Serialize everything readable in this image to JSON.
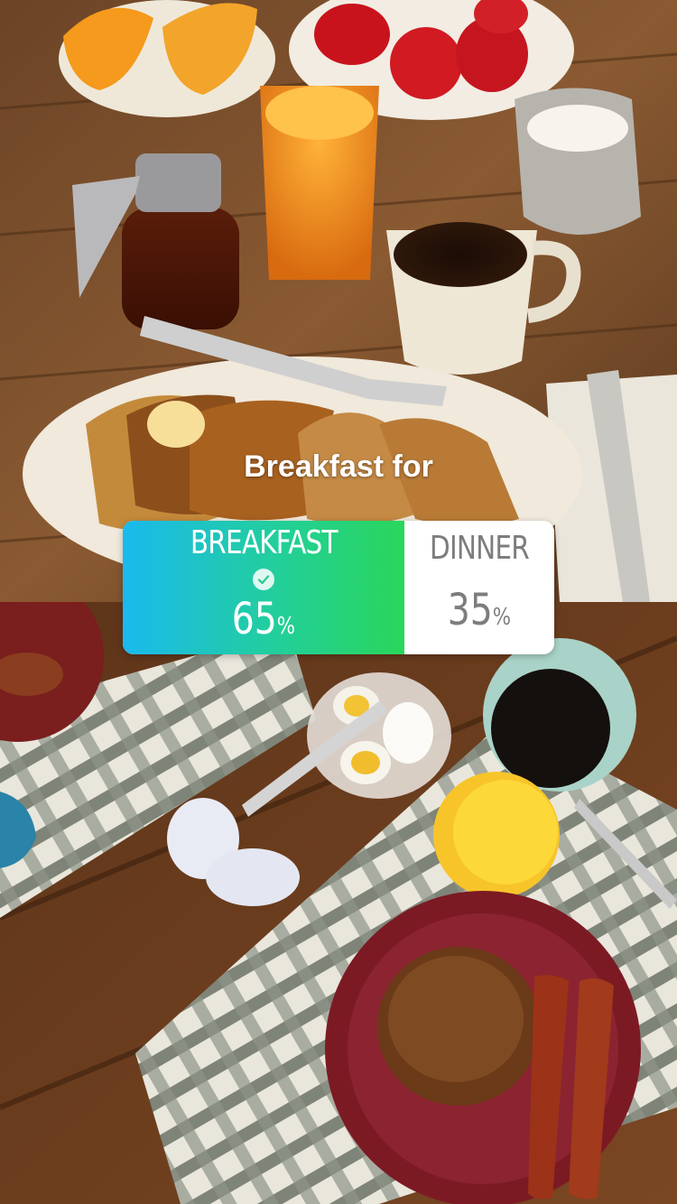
{
  "story": {
    "question": "Breakfast for",
    "poll": {
      "option_a": {
        "label": "BREAKFAST",
        "percent": "65",
        "selected": true
      },
      "option_b": {
        "label": "DINNER",
        "percent": "35",
        "selected": false
      },
      "percent_sign": "%"
    }
  },
  "colors": {
    "gradient_start": "#1ab9ee",
    "gradient_end": "#2ad65a",
    "muted_text": "#7d7d7d",
    "background": "#ffffff"
  },
  "icons": {
    "selected_marker": "check-circle-icon"
  }
}
